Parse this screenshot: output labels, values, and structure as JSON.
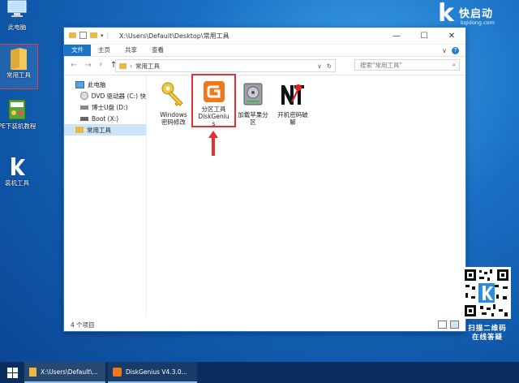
{
  "desktop": {
    "icons": [
      {
        "label": "此电脑"
      },
      {
        "label": "常用工具"
      },
      {
        "label": "PE下装机教程"
      },
      {
        "label": "装机工具"
      }
    ]
  },
  "brand": {
    "logo_letter": "k",
    "name": "快启动",
    "url": "kqidong.com"
  },
  "window": {
    "title_path": "X:\\Users\\Default\\Desktop\\常用工具",
    "controls": {
      "minimize": "—",
      "maximize": "☐",
      "close": "✕"
    },
    "ribbon_tabs": [
      "文件",
      "主页",
      "共享",
      "查看"
    ],
    "ribbon_right": {
      "expand": "∨",
      "help": "?"
    },
    "address": {
      "crumb": "常用工具",
      "search_placeholder": "搜索\"常用工具\""
    },
    "nav_tree": [
      {
        "label": "此电脑"
      },
      {
        "label": "DVD 驱动器 (C:) 快"
      },
      {
        "label": "博士U盘 (D:)"
      },
      {
        "label": "Boot (X:)"
      },
      {
        "label": "常用工具"
      }
    ],
    "files": [
      {
        "line1": "Windows",
        "line2": "密码修改",
        "line3": ""
      },
      {
        "line1": "分区工具",
        "line2": "DiskGeniu",
        "line3": "s"
      },
      {
        "line1": "加载苹果分",
        "line2": "区",
        "line3": ""
      },
      {
        "line1": "开机密码破",
        "line2": "解",
        "line3": ""
      }
    ],
    "status": "4 个项目"
  },
  "qr_caption": {
    "line1": "扫描二维码",
    "line2": "在线答疑"
  },
  "taskbar": {
    "items": [
      {
        "label": "X:\\Users\\Default\\..."
      },
      {
        "label": "DiskGenius V4.3.0..."
      }
    ]
  },
  "colors": {
    "accent": "#1a73c9",
    "highlight_red": "#e53030",
    "folder": "#e8b84a"
  }
}
